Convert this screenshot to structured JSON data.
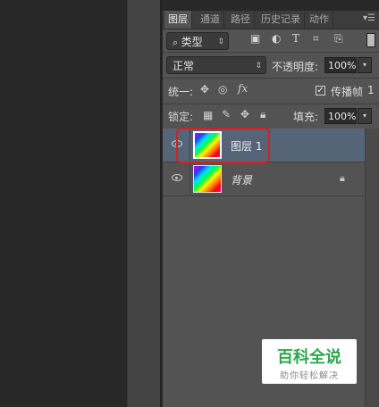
{
  "tabs": [
    {
      "label": "图层",
      "active": true
    },
    {
      "label": "通道",
      "active": false
    },
    {
      "label": "路径",
      "active": false
    },
    {
      "label": "历史记录",
      "active": false
    },
    {
      "label": "动作",
      "active": false
    }
  ],
  "panel_menu_icon": "panel-menu-icon",
  "filter": {
    "kind_label": "类型",
    "search_icon": "search-icon"
  },
  "blend": {
    "mode": "正常",
    "opacity_label": "不透明度:",
    "opacity_value": "100%"
  },
  "unify": {
    "label": "统一:",
    "propagate_label": "传播帧",
    "propagate_value": "1",
    "propagate_checked": true
  },
  "lock": {
    "label": "锁定:",
    "fill_label": "填充:",
    "fill_value": "100%"
  },
  "layers": [
    {
      "name": "图层 1",
      "visible": true,
      "selected": true,
      "locked": false
    },
    {
      "name": "背景",
      "visible": true,
      "selected": false,
      "locked": true
    }
  ],
  "watermark": {
    "title": "百科全说",
    "subtitle": "助你轻松解决"
  },
  "colors": {
    "panel": "#535353",
    "selected_row": "#566478",
    "highlight": "#d42020",
    "watermark_green": "#2aa84a"
  }
}
